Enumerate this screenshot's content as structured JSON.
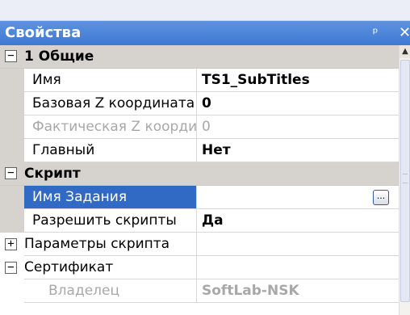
{
  "panel": {
    "title": "Свойства",
    "pin_glyph": "ᵖ",
    "close_glyph": "✕"
  },
  "categories": [
    {
      "toggle": "−",
      "label": "1 Общие"
    },
    {
      "toggle": "−",
      "label": "Скрипт"
    }
  ],
  "properties": {
    "name": {
      "label": "Имя",
      "value": "TS1_SubTitles"
    },
    "base_z": {
      "label": "Базовая Z координата",
      "value": "0"
    },
    "actual_z": {
      "label": "Фактическая Z координата",
      "value": "0"
    },
    "main": {
      "label": "Главный",
      "value": "Нет"
    },
    "task_name": {
      "label": "Имя Задания",
      "value": "",
      "button": "..."
    },
    "allow_scripts": {
      "label": "Разрешить скрипты",
      "value": "Да"
    },
    "script_params": {
      "toggle": "+",
      "label": "Параметры скрипта",
      "value": ""
    },
    "certificate": {
      "toggle": "−",
      "label": "Сертификат",
      "value": ""
    },
    "owner": {
      "label": "Владелец",
      "value": "SoftLab-NSK"
    }
  },
  "scrollbar": {
    "up_arrow": "▲"
  },
  "colors": {
    "title_bar": "#3f78d3",
    "selection": "#316ac5",
    "category_bg": "#d6d3ce",
    "disabled_text": "#a8a8a8"
  }
}
